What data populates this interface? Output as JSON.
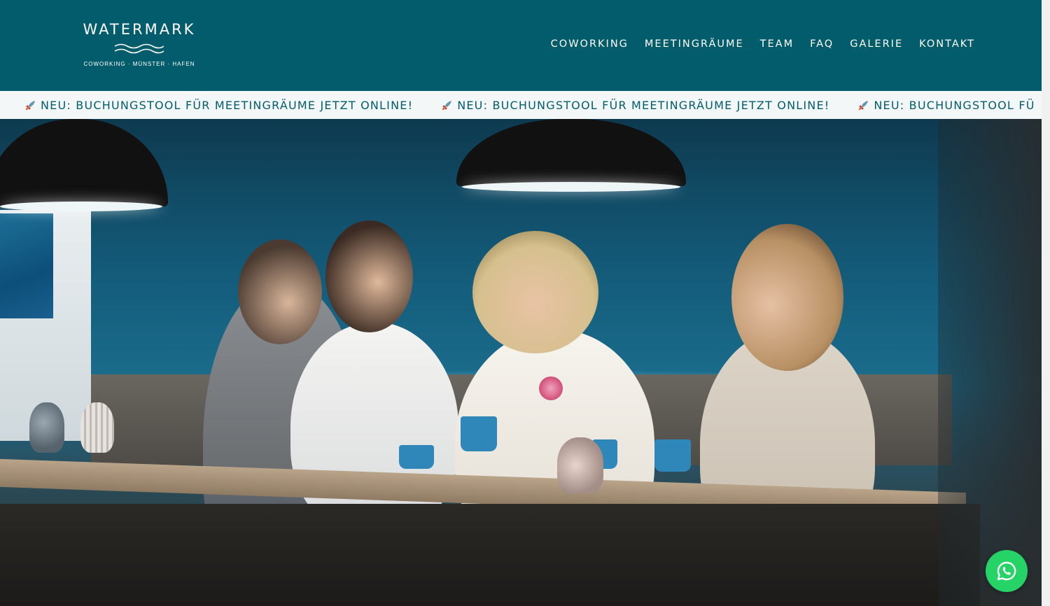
{
  "brand": {
    "name": "WATERMARK",
    "tagline": "COWORKING · MÜNSTER · HAFEN"
  },
  "nav": {
    "items": [
      {
        "label": "COWORKING"
      },
      {
        "label": "MEETINGRÄUME"
      },
      {
        "label": "TEAM"
      },
      {
        "label": "FAQ"
      },
      {
        "label": "GALERIE"
      },
      {
        "label": "KONTAKT"
      }
    ]
  },
  "ticker": {
    "icon": "rocket-icon",
    "messages": [
      "NEU: BUCHUNGSTOOL FÜR MEETINGRÄUME JETZT ONLINE!",
      "NEU: BUCHUNGSTOOL FÜR MEETINGRÄUME JETZT ONLINE!",
      "NEU: BUCHUNGSTOOL FÜ"
    ]
  },
  "hero": {
    "image": "four-women-laughing-at-coworking-table"
  },
  "whatsapp": {
    "icon": "whatsapp-icon"
  },
  "colors": {
    "header_bg": "#035c6b",
    "ticker_bg": "#f4f7f8",
    "ticker_text": "#035c6b",
    "whatsapp": "#25d366"
  }
}
